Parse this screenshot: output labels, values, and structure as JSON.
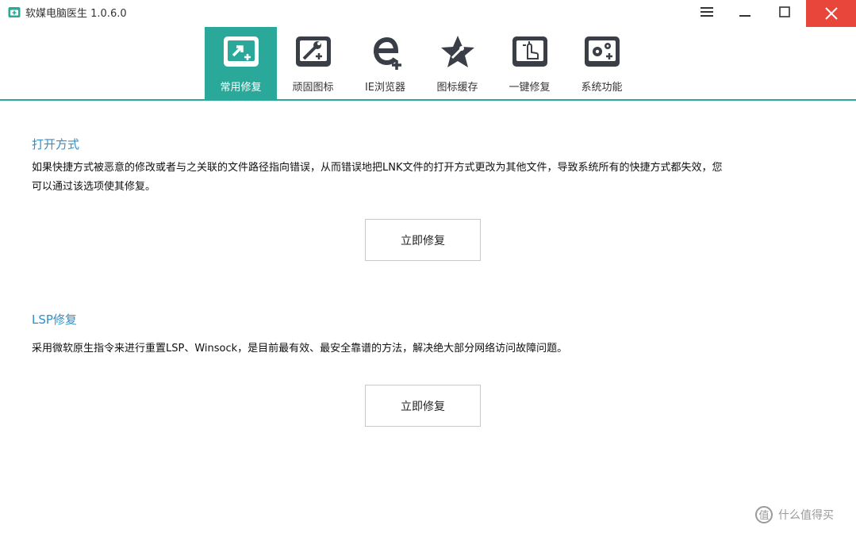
{
  "window": {
    "title": "软媒电脑医生 1.0.6.0"
  },
  "colors": {
    "accent": "#2aa99a",
    "close": "#e8463a",
    "section_title": "#2f8fc9"
  },
  "tabs": [
    {
      "label": "常用修复",
      "icon": "repair-shortcut-icon",
      "active": true
    },
    {
      "label": "顽固图标",
      "icon": "tools-icon",
      "active": false
    },
    {
      "label": "IE浏览器",
      "icon": "ie-plus-icon",
      "active": false
    },
    {
      "label": "图标缓存",
      "icon": "star-icon",
      "active": false
    },
    {
      "label": "一键修复",
      "icon": "hand-click-icon",
      "active": false
    },
    {
      "label": "系统功能",
      "icon": "gears-icon",
      "active": false
    }
  ],
  "sections": [
    {
      "title": "打开方式",
      "desc_line1": "如果快捷方式被恶意的修改或者与之关联的文件路径指向错误，从而错误地把LNK文件的打开方式更改为其他文件，导致系统所有的快捷方式都失效，您",
      "desc_line2": "可以通过该选项使其修复。",
      "button": "立即修复"
    },
    {
      "title": "LSP修复",
      "desc_line1": "采用微软原生指令来进行重置LSP、Winsock，是目前最有效、最安全靠谱的方法，解决绝大部分网络访问故障问题。",
      "button": "立即修复"
    }
  ],
  "watermark": {
    "text": "什么值得买",
    "icon": "smzdm-logo-icon"
  }
}
